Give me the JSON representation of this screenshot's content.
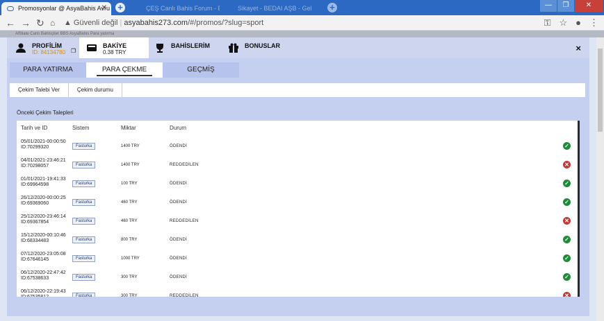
{
  "browser": {
    "active_tab_title": "Promosyonlar @ AsyaBahis Avru",
    "inactive_tab_1": "ÇEŞ Canlı Bahis Forum - Bahis...",
    "inactive_tab_2": "Sikayet - BEDAI AŞB - Gelinme",
    "security_label": "Güvenli değil",
    "url_host": "asyabahis273.com",
    "url_path": "/#/promos/?slug=sport",
    "bookmarks": "Affiliate   Canlı Bahisçiler   BBS   AsyaBahis   Para yatırma"
  },
  "header": {
    "profile_label": "PROFİLİM",
    "profile_id": "ID: 84134780",
    "balance_label": "BAKİYE",
    "balance_value": "0.38 TRY",
    "bets_label": "BAHİSLERİM",
    "bonus_label": "BONUSLAR",
    "close_label": "×"
  },
  "subtabs": [
    "PARA YATIRMA",
    "PARA ÇEKME",
    "GEÇMİŞ"
  ],
  "actions": [
    "Çekim Talebi Ver",
    "Çekim durumu"
  ],
  "section_title": "Önceki Çekim Talepleri",
  "table": {
    "columns": [
      "Tarih ve ID",
      "Sistem",
      "Miktar",
      "Durum"
    ],
    "rows": [
      {
        "date": "05/01/2021-00:00:50",
        "id": "ID:70299320",
        "system": "Fasturka",
        "amount": "1400 TRY",
        "status": "ÖDENDİ",
        "ok": true
      },
      {
        "date": "04/01/2021-23:46:21",
        "id": "ID:70298057",
        "system": "Fasturka",
        "amount": "1400 TRY",
        "status": "REDDEDİLEN",
        "ok": false
      },
      {
        "date": "01/01/2021-19:41:33",
        "id": "ID:69964598",
        "system": "Fasturka",
        "amount": "100 TRY",
        "status": "ÖDENDİ",
        "ok": true
      },
      {
        "date": "26/12/2020-00:00:25",
        "id": "ID:69369060",
        "system": "Fasturka",
        "amount": "460 TRY",
        "status": "ÖDENDİ",
        "ok": true
      },
      {
        "date": "25/12/2020-23:46:14",
        "id": "ID:69367854",
        "system": "Fasturka",
        "amount": "460 TRY",
        "status": "REDDEDİLEN",
        "ok": false
      },
      {
        "date": "15/12/2020-00:10:46",
        "id": "ID:68334483",
        "system": "Fasturka",
        "amount": "800 TRY",
        "status": "ÖDENDİ",
        "ok": true
      },
      {
        "date": "07/12/2020-23:05:08",
        "id": "ID:67646145",
        "system": "Fasturka",
        "amount": "1000 TRY",
        "status": "ÖDENDİ",
        "ok": true
      },
      {
        "date": "06/12/2020-22:47:42",
        "id": "ID:67538633",
        "system": "Fasturka",
        "amount": "300 TRY",
        "status": "ÖDENDİ",
        "ok": true
      },
      {
        "date": "06/12/2020-22:19:43",
        "id": "ID:67535812",
        "system": "Fasturka",
        "amount": "300 TRY",
        "status": "REDDEDİLEN",
        "ok": false
      }
    ]
  },
  "colors": {
    "ok": "#1f8a3a",
    "rejected": "#c23a3a",
    "chrome_blue": "#2b69c3"
  }
}
